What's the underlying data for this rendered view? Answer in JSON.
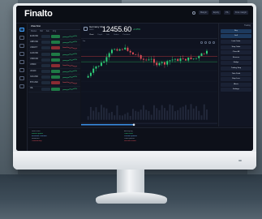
{
  "brand": {
    "logo": "Finalto"
  },
  "header": {
    "controls": [
      "Margin",
      "Equity",
      "P/L",
      "Free margin"
    ]
  },
  "watchlist": {
    "title": "Watchlist",
    "tabs": [
      "Market",
      "Bid",
      "Ask",
      "Chg"
    ],
    "rows": [
      {
        "symbol": "EURUSD",
        "dir": "up"
      },
      {
        "symbol": "GBPUSD",
        "dir": "up"
      },
      {
        "symbol": "USDJPY",
        "dir": "dn"
      },
      {
        "symbol": "AUDUSD",
        "dir": "up"
      },
      {
        "symbol": "USDCAD",
        "dir": "up"
      },
      {
        "symbol": "US500",
        "dir": "dn"
      },
      {
        "symbol": "UK100",
        "dir": "up"
      },
      {
        "symbol": "XAUUSD",
        "dir": "up"
      },
      {
        "symbol": "BTCUSD",
        "dir": "dn"
      },
      {
        "symbol": "OIL",
        "dir": "up"
      }
    ]
  },
  "chart": {
    "symbol": "Germany 30",
    "subtitle": "DE30",
    "price": "12455.60",
    "change": "+0.45%",
    "timeframe": "1m",
    "tabs": [
      "Chart",
      "Depth",
      "Info",
      "Orders",
      "Positions"
    ]
  },
  "right_panel": {
    "header": "Trading",
    "buttons": [
      "Buy",
      "Sell",
      "Limit Order",
      "Stop Order",
      "Close All",
      "Reverse",
      "Hedge",
      "Trailing Stop",
      "Take Profit",
      "Stop Loss",
      "Alerts",
      "Settings"
    ]
  },
  "bottom_panel": {
    "left_lines": [
      "News feed",
      "Market update",
      "Economic calendar",
      "Headlines",
      "Commentary"
    ],
    "right_lines": [
      "Activity log",
      "Order filled",
      "Position opened",
      "Order placed",
      "Session events"
    ]
  },
  "colors": {
    "accent": "#3fa0ff",
    "up": "#2fd07a",
    "down": "#e24d57",
    "screen_bg": "#10131c"
  }
}
